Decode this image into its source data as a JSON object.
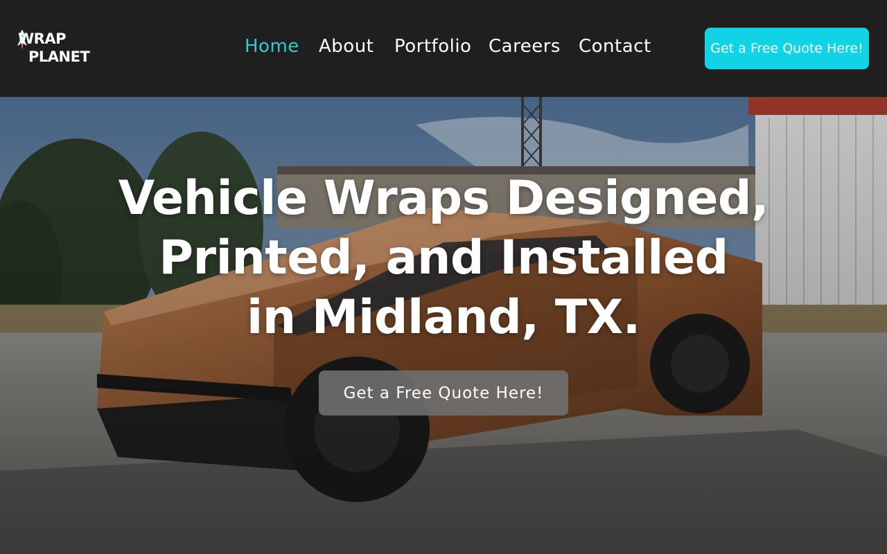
{
  "brand": {
    "logo_line1": "WRAP",
    "logo_line2": "PLANET",
    "accent_color": "#11d3e6",
    "active_nav_color": "#35c9d4"
  },
  "nav": {
    "items": [
      {
        "label": "Home",
        "active": true
      },
      {
        "label": "About",
        "active": false
      },
      {
        "label": "Portfolio",
        "active": false
      },
      {
        "label": "Careers",
        "active": false
      },
      {
        "label": "Contact",
        "active": false
      }
    ]
  },
  "header": {
    "cta_label": "Get a Free Quote Here!"
  },
  "hero": {
    "headline_lines": [
      "Vehicle Wraps Designed,",
      "Printed, and Installed",
      "in Midland, TX."
    ],
    "cta_label": "Get a Free Quote Here!",
    "background_image": "copper-wrapped-cybertruck-photo"
  }
}
